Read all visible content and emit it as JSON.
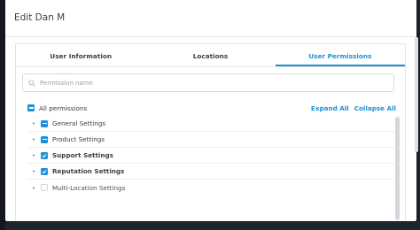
{
  "modal": {
    "title": "Edit Dan M"
  },
  "tabs": [
    {
      "label": "User Information",
      "active": false
    },
    {
      "label": "Locations",
      "active": false
    },
    {
      "label": "User Permissions",
      "active": true
    }
  ],
  "search": {
    "placeholder": "Permission name",
    "value": "",
    "icon": "search-icon"
  },
  "permissions": {
    "all_label": "All permissions",
    "all_state": "indeterminate",
    "expand_all": "Expand All",
    "collapse_all": "Collapse All",
    "items": [
      {
        "label": "General Settings",
        "state": "indeterminate",
        "bold": false
      },
      {
        "label": "Product Settings",
        "state": "indeterminate",
        "bold": false
      },
      {
        "label": "Support Settings",
        "state": "checked",
        "bold": true
      },
      {
        "label": "Reputation Settings",
        "state": "checked",
        "bold": true
      },
      {
        "label": "Multi-Location Settings",
        "state": "unchecked",
        "bold": false
      }
    ]
  },
  "colors": {
    "accent": "#1e90d6",
    "text": "#3a4049",
    "backdrop": "#1b2027"
  }
}
